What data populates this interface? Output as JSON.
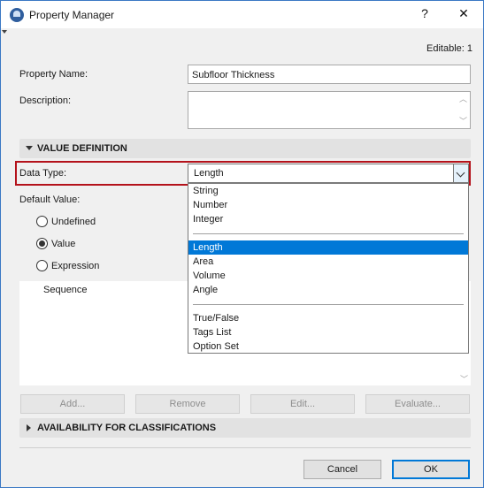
{
  "window": {
    "title": "Property Manager",
    "help_glyph": "?",
    "close_glyph": "✕"
  },
  "editable_text": "Editable: 1",
  "property_name": {
    "label": "Property Name:",
    "value": "Subfloor Thickness"
  },
  "description": {
    "label": "Description:",
    "value": ""
  },
  "value_definition": {
    "title": "VALUE DEFINITION",
    "data_type_label": "Data Type:",
    "data_type_value": "Length",
    "default_value_label": "Default Value:",
    "options": [
      {
        "label": "Undefined",
        "checked": false
      },
      {
        "label": "Value",
        "checked": true
      },
      {
        "label": "Expression",
        "checked": false
      }
    ],
    "sequence_label": "Sequence"
  },
  "dropdown": {
    "groups": [
      [
        "String",
        "Number",
        "Integer"
      ],
      [
        "Length",
        "Area",
        "Volume",
        "Angle"
      ],
      [
        "True/False",
        "Tags List",
        "Option Set"
      ]
    ],
    "selected": "Length"
  },
  "actions": {
    "add": "Add...",
    "remove": "Remove",
    "edit": "Edit...",
    "evaluate": "Evaluate..."
  },
  "availability": {
    "title": "AVAILABILITY FOR CLASSIFICATIONS"
  },
  "footer": {
    "cancel": "Cancel",
    "ok": "OK"
  },
  "colors": {
    "highlight_border": "#b4121b",
    "selection": "#0078d7"
  }
}
